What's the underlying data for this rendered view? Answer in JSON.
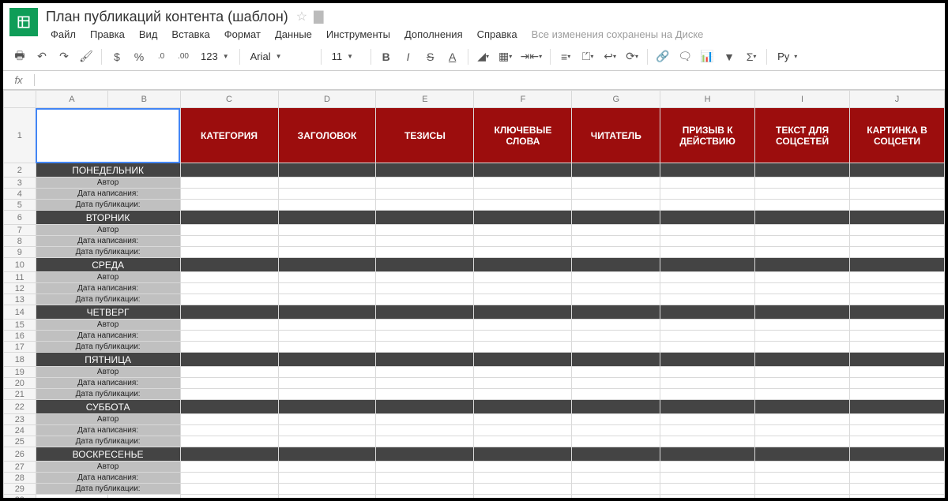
{
  "doc": {
    "title": "План публикаций контента (шаблон)"
  },
  "menu": {
    "file": "Файл",
    "edit": "Правка",
    "view": "Вид",
    "insert": "Вставка",
    "format": "Формат",
    "data": "Данные",
    "tools": "Инструменты",
    "addons": "Дополнения",
    "help": "Справка"
  },
  "save_status": "Все изменения сохранены на Диске",
  "toolbar": {
    "currency": "$",
    "percent": "%",
    "dec_dec": ".0",
    "dec_inc": ".00",
    "more_fmt": "123",
    "font": "Arial",
    "size": "11",
    "script": "Рy"
  },
  "fx": {
    "label": "fx"
  },
  "cols": [
    "A",
    "B",
    "C",
    "D",
    "E",
    "F",
    "G",
    "H",
    "I",
    "J"
  ],
  "headers": {
    "C": "КАТЕГОРИЯ",
    "D": "ЗАГОЛОВОК",
    "E": "ТЕЗИСЫ",
    "F": "КЛЮЧЕВЫЕ СЛОВА",
    "G": "ЧИТАТЕЛЬ",
    "H": "ПРИЗЫВ К ДЕЙСТВИЮ",
    "I": "ТЕКСТ ДЛЯ СОЦСЕТЕЙ",
    "J": "КАРТИНКА В СОЦСЕТИ"
  },
  "days": [
    "ПОНЕДЕЛЬНИК",
    "ВТОРНИК",
    "СРЕДА",
    "ЧЕТВЕРГ",
    "ПЯТНИЦА",
    "СУББОТА",
    "ВОСКРЕСЕНЬЕ"
  ],
  "meta": {
    "author": "Автор",
    "written": "Дата написания:",
    "published": "Дата публикации:"
  }
}
